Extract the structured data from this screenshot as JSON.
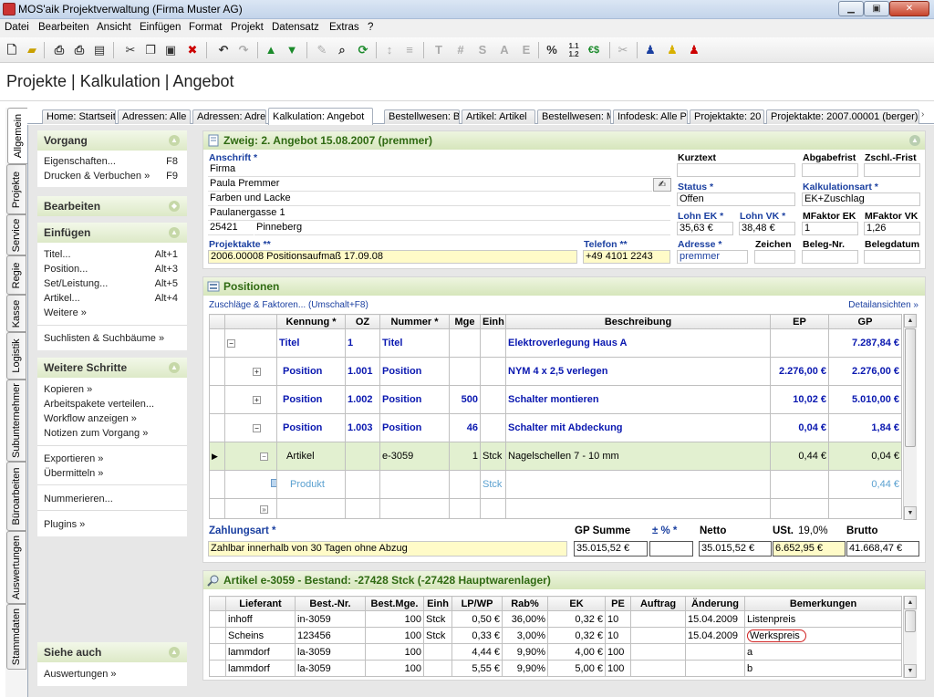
{
  "window": {
    "title": "MOS'aik Projektverwaltung (Firma Muster AG)"
  },
  "menu": [
    "Datei",
    "Bearbeiten",
    "Ansicht",
    "Einfügen",
    "Format",
    "Projekt",
    "Datensatz",
    "Extras",
    "?"
  ],
  "toolbar": {
    "t_label": "T",
    "hash_label": "#",
    "s_label": "S",
    "a_label": "A",
    "e_label": "E",
    "percent_label": "%",
    "euro_label": "€$"
  },
  "heading": "Projekte | Kalkulation | Angebot",
  "vtabs": [
    "Allgemein",
    "Projekte",
    "Service",
    "Regie",
    "Kasse",
    "Logistik",
    "Subunternehmer",
    "Büroarbeiten",
    "Auswertungen",
    "Stammdaten"
  ],
  "tabs": [
    "Home: Startseite",
    "Adressen: Alle",
    "Adressen: Adres",
    "Kalkulation: Angebot",
    "Bestellwesen: B",
    "Artikel: Artikel",
    "Bestellwesen: M",
    "Infodesk: Alle P",
    "Projektakte: 20",
    "Projektakte: 2007.00001 (berger)"
  ],
  "left": {
    "vorgang": {
      "title": "Vorgang",
      "items": [
        {
          "label": "Eigenschaften...",
          "key": "F8"
        },
        {
          "label": "Drucken & Verbuchen »",
          "key": "F9"
        }
      ]
    },
    "bearbeiten": {
      "title": "Bearbeiten"
    },
    "einfuegen": {
      "title": "Einfügen",
      "items": [
        {
          "label": "Titel...",
          "key": "Alt+1"
        },
        {
          "label": "Position...",
          "key": "Alt+3"
        },
        {
          "label": "Set/Leistung...",
          "key": "Alt+5"
        },
        {
          "label": "Artikel...",
          "key": "Alt+4"
        },
        {
          "label": "Weitere »",
          "key": ""
        }
      ],
      "extra": "Suchlisten & Suchbäume »"
    },
    "weitere": {
      "title": "Weitere Schritte",
      "items": [
        "Kopieren »",
        "Arbeitspakete verteilen...",
        "Workflow anzeigen »",
        "Notizen zum Vorgang »",
        "Exportieren »",
        "Übermitteln »",
        "Nummerieren...",
        "Plugins »"
      ]
    },
    "sieheauch": {
      "title": "Siehe auch",
      "items": [
        "Auswertungen »"
      ]
    }
  },
  "zweig": {
    "title": "Zweig: 2. Angebot 15.08.2007 (premmer)",
    "anschrift_label": "Anschrift *",
    "anschrift": [
      "Firma",
      "Paula Premmer",
      "Farben und Lacke",
      "Paulanergasse 1"
    ],
    "plz": "25421",
    "ort": "Pinneberg",
    "projektakte_label": "Projektakte **",
    "projektakte": "2006.00008 Positionsaufmaß 17.09.08",
    "telefon_label": "Telefon **",
    "telefon": "+49 4101 2243",
    "kurztext_label": "Kurztext",
    "kurztext": "",
    "abgabefrist_label": "Abgabefrist",
    "abgabefrist": "",
    "zschl_label": "Zschl.-Frist",
    "zschl": "",
    "status_label": "Status *",
    "status": "Offen",
    "kalkart_label": "Kalkulationsart *",
    "kalkart": "EK+Zuschlag",
    "lohnek_label": "Lohn EK *",
    "lohnek": "35,63 €",
    "lohnvk_label": "Lohn VK *",
    "lohnvk": "38,48 €",
    "mfek_label": "MFaktor EK",
    "mfek": "1",
    "mfvk_label": "MFaktor VK",
    "mfvk": "1,26",
    "adresse_label": "Adresse *",
    "adresse": "premmer",
    "zeichen_label": "Zeichen",
    "zeichen": "",
    "belegnr_label": "Beleg-Nr.",
    "belegnr": "",
    "belegdatum_label": "Belegdatum",
    "belegdatum": ""
  },
  "positionen": {
    "title": "Positionen",
    "link_left": "Zuschläge & Faktoren... (Umschalt+F8)",
    "link_right": "Detailansichten »",
    "columns": [
      "Kennung *",
      "OZ",
      "Nummer *",
      "Mge",
      "Einh",
      "Beschreibung",
      "EP",
      "GP"
    ],
    "rows": [
      {
        "kennung": "Titel",
        "oz": "1",
        "nummer": "Titel",
        "mge": "",
        "einh": "",
        "beschreibung": "Elektroverlegung Haus A",
        "ep": "",
        "gp": "7.287,84 €"
      },
      {
        "kennung": "Position",
        "oz": "1.001",
        "nummer": "Position",
        "mge": "",
        "einh": "",
        "beschreibung": "NYM 4 x 2,5 verlegen",
        "ep": "2.276,00 €",
        "gp": "2.276,00 €"
      },
      {
        "kennung": "Position",
        "oz": "1.002",
        "nummer": "Position",
        "mge": "500",
        "einh": "",
        "beschreibung": "Schalter montieren",
        "ep": "10,02 €",
        "gp": "5.010,00 €"
      },
      {
        "kennung": "Position",
        "oz": "1.003",
        "nummer": "Position",
        "mge": "46",
        "einh": "",
        "beschreibung": "Schalter mit Abdeckung",
        "ep": "0,04 €",
        "gp": "1,84 €"
      },
      {
        "kennung": "Artikel",
        "oz": "",
        "nummer": "e-3059",
        "mge": "1",
        "einh": "Stck",
        "beschreibung": "Nagelschellen 7 - 10 mm",
        "ep": "0,44 €",
        "gp": "0,04 €"
      },
      {
        "kennung": "Produkt",
        "oz": "",
        "nummer": "",
        "mge": "",
        "einh": "Stck",
        "beschreibung": "",
        "ep": "",
        "gp": "0,44 €"
      }
    ],
    "zahlungsart_label": "Zahlungsart *",
    "zahlungsart": "Zahlbar innerhalb von 30 Tagen ohne Abzug",
    "gpsumme_label": "GP Summe",
    "gpsumme": "35.015,52 €",
    "proz_label": "± % *",
    "proz": "",
    "netto_label": "Netto",
    "netto": "35.015,52 €",
    "ust_label": "USt.",
    "ust_rate": "19,0%",
    "ust": "6.652,95 €",
    "brutto_label": "Brutto",
    "brutto": "41.668,47 €"
  },
  "artikel": {
    "title": "Artikel e-3059 - Bestand: -27428 Stck (-27428 Hauptwarenlager)",
    "columns": [
      "Lieferant",
      "Best.-Nr.",
      "Best.Mge.",
      "Einh",
      "LP/WP",
      "Rab%",
      "EK",
      "PE",
      "Auftrag",
      "Änderung",
      "Bemerkungen"
    ],
    "rows": [
      {
        "lieferant": "inhoff",
        "bestnr": "in-3059",
        "mge": "100",
        "einh": "Stck",
        "lp": "0,50 €",
        "rab": "36,00%",
        "ek": "0,32 €",
        "pe": "10",
        "auftrag": "",
        "aenderung": "15.04.2009",
        "bem": "Listenpreis"
      },
      {
        "lieferant": "Scheins",
        "bestnr": "123456",
        "mge": "100",
        "einh": "Stck",
        "lp": "0,33 €",
        "rab": "3,00%",
        "ek": "0,32 €",
        "pe": "10",
        "auftrag": "",
        "aenderung": "15.04.2009",
        "bem": "Werkspreis"
      },
      {
        "lieferant": "lammdorf",
        "bestnr": "la-3059",
        "mge": "100",
        "einh": "",
        "lp": "4,44 €",
        "rab": "9,90%",
        "ek": "4,00 €",
        "pe": "100",
        "auftrag": "",
        "aenderung": "",
        "bem": "a"
      },
      {
        "lieferant": "lammdorf",
        "bestnr": "la-3059",
        "mge": "100",
        "einh": "",
        "lp": "5,55 €",
        "rab": "9,90%",
        "ek": "5,00 €",
        "pe": "100",
        "auftrag": "",
        "aenderung": "",
        "bem": "b"
      }
    ]
  },
  "colors": {
    "accent_green": "#2f6a12",
    "label_blue": "#1a3fa0",
    "row_blue": "#0a18b0",
    "highlight_row": "#e2f0d0",
    "yellow_field": "#fffbc8"
  }
}
